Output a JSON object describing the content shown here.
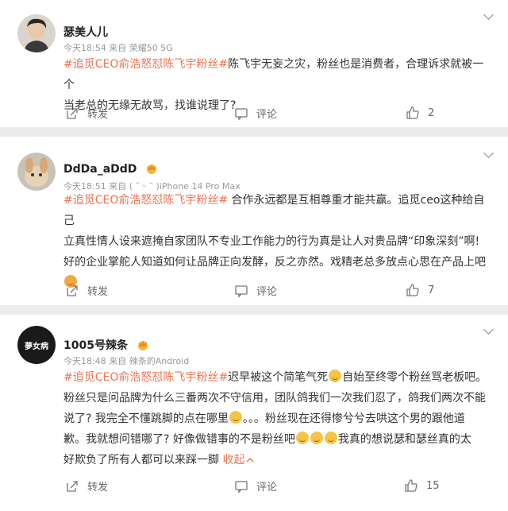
{
  "comments": [
    {
      "name": "瑟美人儿",
      "meta": "今天18:54  来自 荣耀50 5G",
      "tag": "#追觅CEO俞浩怒怼陈飞宇粉丝#",
      "text_line1": "陈飞宇无妄之灾，粉丝也是消费者，合理诉求就被一个",
      "text_line2": "当老总的无缘无故骂，找谁说理了?",
      "forward": "转发",
      "comment": "评论",
      "likes": "2"
    },
    {
      "name": "DdDa_aDdD",
      "meta": "今天18:51  来自 ( ˘ ᵕ ˘ )iPhone 14 Pro Max",
      "tag": "#追觅CEO俞浩怒怼陈飞宇粉丝#",
      "text_line1": " 合作永远都是互相尊重才能共赢。追觅ceo这种给自己",
      "text_line2": "立真性情人设来遮掩自家团队不专业工作能力的行为真是让人对贵品牌“印象深刻”啊!",
      "text_line3": "好的企业掌舵人知道如何让品牌正向发酵，反之亦然。戏精老总多放点心思在产品上吧",
      "forward": "转发",
      "comment": "评论",
      "likes": "7"
    },
    {
      "name": "1005号辣条",
      "avatar_text": "我们夢女病",
      "meta": "今天18:48  来自 辣条的Android",
      "tag": "#追觅CEO俞浩怒怼陈飞宇粉丝#",
      "text_line1": "迟早被这个简笔气死",
      "text_line1b": "自始至终零个粉丝骂老板吧。",
      "text_line2": "粉丝只是问品牌为什么三番两次不守信用，团队鸽我们一次我们忍了，鸽我们两次不能",
      "text_line3a": "说了? 我完全不懂跳脚的点在哪里",
      "text_line3b": "。。。粉丝现在还得惨兮兮去哄这个男的跟他道",
      "text_line4a": "歉。我就想问错哪了? 好像做错事的不是粉丝吧",
      "text_line4b": "我真的想说瑟和瑟丝真的太",
      "text_line5": "好欺负了所有人都可以来踩一脚",
      "more": "收起",
      "forward": "转发",
      "comment": "评论",
      "likes": "15"
    }
  ],
  "colors": {
    "accent": "#eb7350",
    "meta": "#999999",
    "background": "#ececec"
  }
}
